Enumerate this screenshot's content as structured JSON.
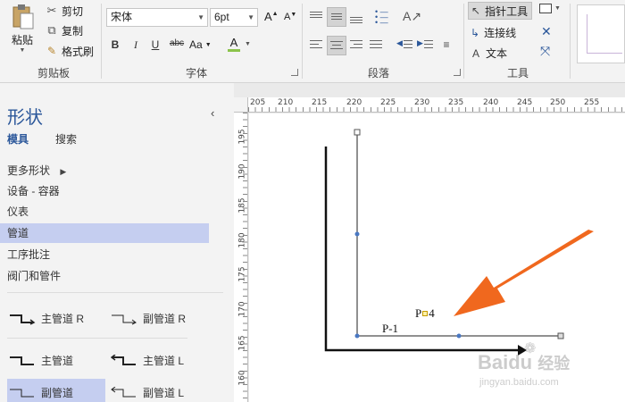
{
  "ribbon": {
    "clipboard": {
      "paste": "粘贴",
      "cut": "剪切",
      "copy": "复制",
      "format_painter": "格式刷",
      "label": "剪贴板"
    },
    "font": {
      "family": "宋体",
      "size": "6pt",
      "bold": "B",
      "italic": "I",
      "underline": "U",
      "strike": "abc",
      "case": "Aa",
      "color": "A",
      "grow": "A",
      "shrink": "A",
      "label": "字体"
    },
    "paragraph": {
      "label": "段落"
    },
    "tools": {
      "pointer": "指针工具",
      "connector": "连接线",
      "text": "文本",
      "label": "工具"
    }
  },
  "shapes_panel": {
    "title": "形状",
    "tabs": [
      "模具",
      "搜索"
    ],
    "more_shapes": "更多形状",
    "items": [
      "设备 - 容器",
      "仪表",
      "管道",
      "工序批注",
      "阀门和管件"
    ],
    "selected_item": "管道",
    "stencils": [
      {
        "label": "主管道 R"
      },
      {
        "label": "副管道 R"
      },
      {
        "label": "主管道"
      },
      {
        "label": "主管道 L"
      },
      {
        "label": "副管道"
      },
      {
        "label": "副管道 L"
      }
    ]
  },
  "ruler": {
    "horizontal": [
      "205",
      "210",
      "215",
      "220",
      "225",
      "230",
      "235",
      "240",
      "245",
      "250",
      "255"
    ],
    "vertical": [
      "195",
      "190",
      "185",
      "180",
      "175",
      "170",
      "165",
      "160"
    ]
  },
  "drawing": {
    "labels": {
      "pipe": "P-1",
      "tag": "P",
      "tag_num": "4"
    }
  },
  "watermark": {
    "brand": "Baidu",
    "brand_cn": "经验",
    "url": "jingyan.baidu.com"
  },
  "colors": {
    "arrow": "#f0681e",
    "selection": "#c5cef0",
    "title": "#2b579a"
  }
}
